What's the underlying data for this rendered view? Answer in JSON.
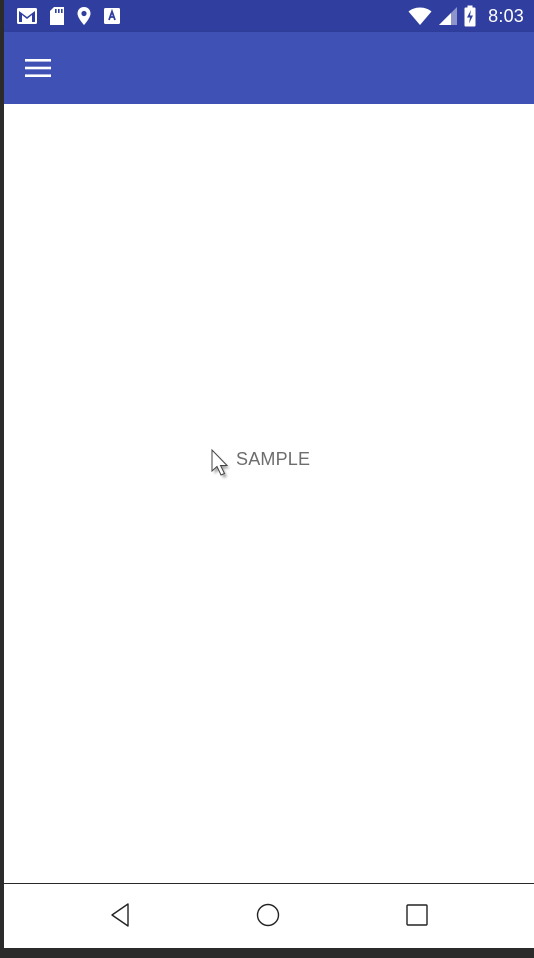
{
  "status_bar": {
    "time": "8:03",
    "left_icons": [
      "gmail-icon",
      "sd-card-icon",
      "location-icon",
      "text-app-icon"
    ],
    "right_icons": [
      "wifi-icon",
      "signal-icon",
      "battery-charging-icon"
    ],
    "background_color": "#303f9f"
  },
  "app_bar": {
    "menu_icon": "hamburger-menu-icon",
    "background_color": "#3f51b5"
  },
  "main": {
    "sample_label": "SAMPLE"
  },
  "nav_bar": {
    "buttons": [
      "back-icon",
      "home-icon",
      "recents-icon"
    ]
  }
}
